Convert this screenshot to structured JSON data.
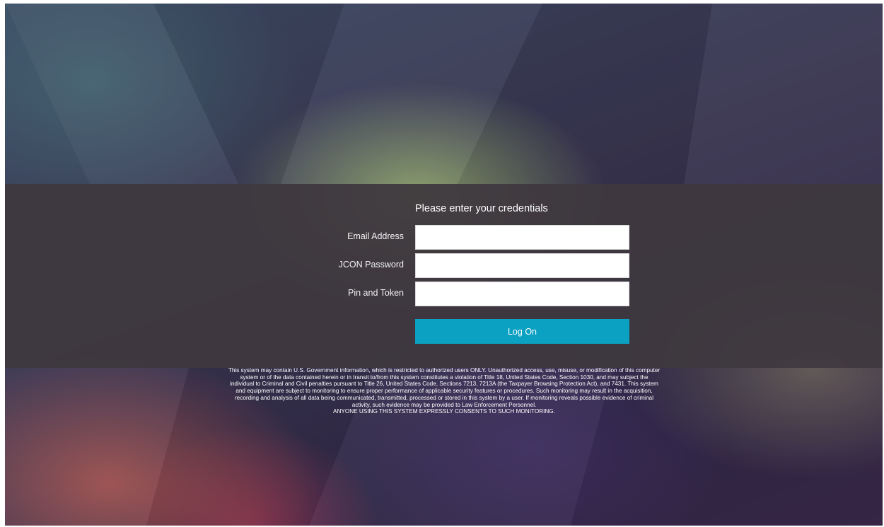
{
  "login": {
    "heading": "Please enter your credentials",
    "fields": [
      {
        "label": "Email Address",
        "value": "",
        "placeholder": ""
      },
      {
        "label": "JCON Password",
        "value": "",
        "placeholder": ""
      },
      {
        "label": "Pin and Token",
        "value": "",
        "placeholder": ""
      }
    ],
    "submit_label": "Log On"
  },
  "notice": {
    "body": "This system may contain U.S. Government information, which is restricted to authorized users ONLY. Unauthorized access, use, misuse, or modification of this computer system or of the data contained herein or in transit to/from this system constitutes a violation of Title 18, United States Code, Section 1030, and may subject the individual to Criminal and Civil penalties pursuant to Title 26, United States Code, Sections 7213, 7213A (the Taxpayer Browsing Protection Act), and 7431. This system and equipment are subject to monitoring to ensure proper performance of applicable security features or procedures. Such monitoring may result in the acquisition, recording and analysis of all data being communicated, transmitted, processed or stored in this system by a user. If monitoring reveals possible evidence of criminal activity, such evidence may be provided to Law Enforcement Personnel.",
    "consent": "ANYONE USING THIS SYSTEM EXPRESSLY CONSENTS TO SUCH MONITORING."
  },
  "colors": {
    "accent": "#0aa1c2",
    "band": "#3e383e"
  }
}
